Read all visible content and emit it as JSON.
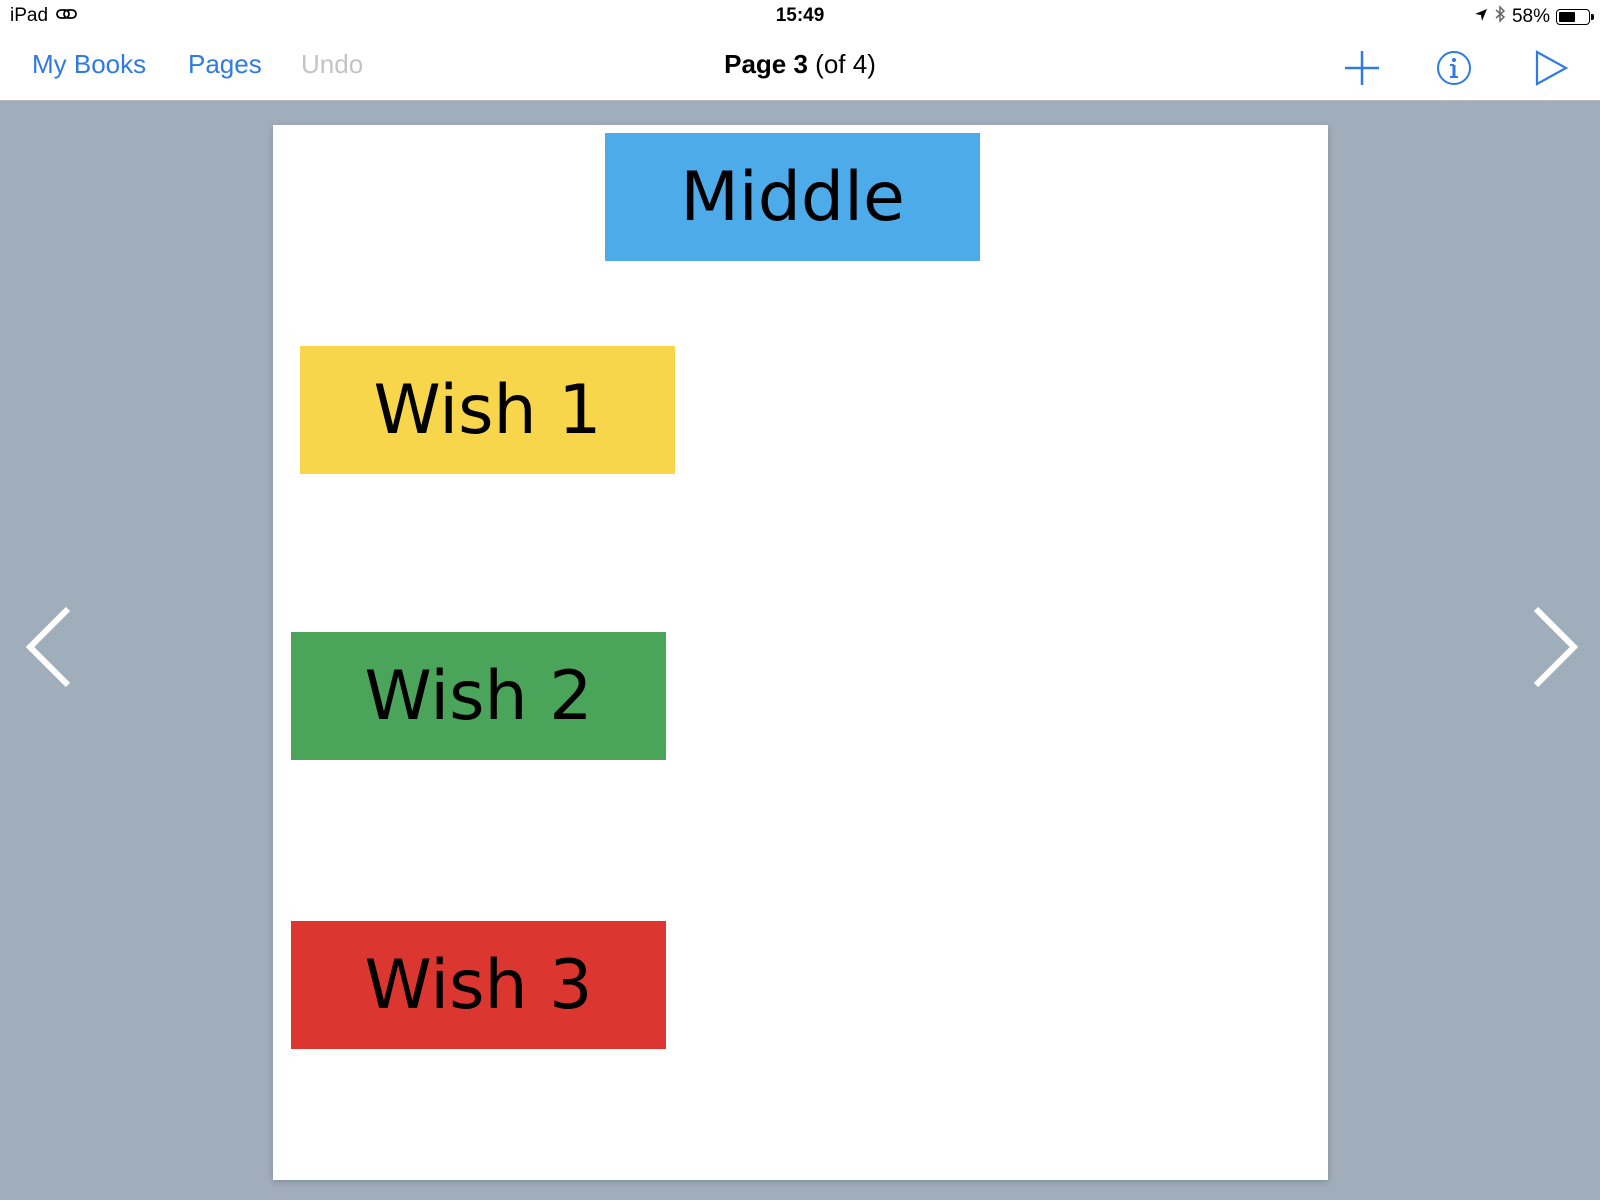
{
  "status_bar": {
    "device": "iPad",
    "time": "15:49",
    "battery_percent": "58%",
    "battery_level": 0.58
  },
  "nav": {
    "my_books": "My Books",
    "pages": "Pages",
    "undo": "Undo",
    "title_strong": "Page 3",
    "title_rest": " (of 4)",
    "accent_color": "#2f7ae5",
    "disabled_color": "#c4c4c6"
  },
  "page": {
    "boxes": [
      {
        "label": "Middle",
        "color": "#4eabea"
      },
      {
        "label": "Wish 1",
        "color": "#f8d64b"
      },
      {
        "label": "Wish 2",
        "color": "#4aa55b"
      },
      {
        "label": "Wish 3",
        "color": "#dc3630"
      }
    ]
  },
  "icons": {
    "add": "plus-icon",
    "info": "info-icon",
    "play": "play-icon",
    "prev": "chevron-left-icon",
    "next": "chevron-right-icon",
    "location": "location-arrow-icon",
    "bluetooth": "bluetooth-icon",
    "link": "link-icon"
  }
}
